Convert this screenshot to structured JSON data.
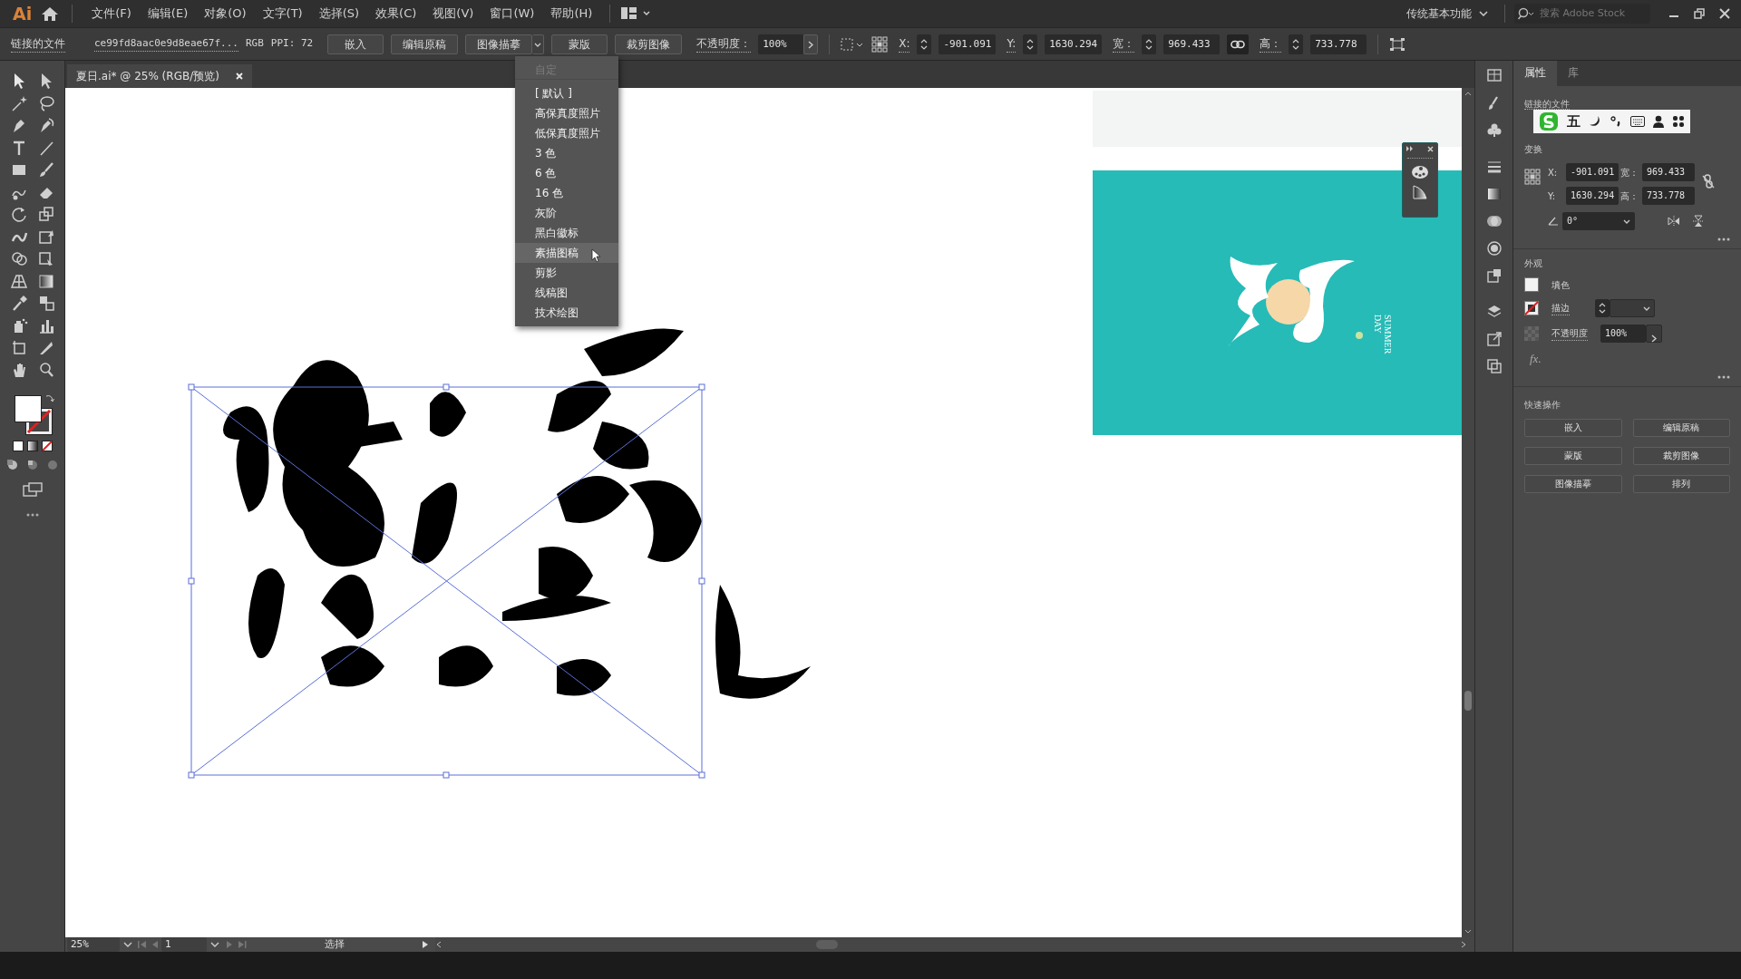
{
  "menubar": {
    "app_logo": "Ai",
    "menus": [
      "文件(F)",
      "编辑(E)",
      "对象(O)",
      "文字(T)",
      "选择(S)",
      "效果(C)",
      "视图(V)",
      "窗口(W)",
      "帮助(H)"
    ],
    "workspace": "传统基本功能",
    "search": {
      "placeholder": "搜索 Adobe Stock"
    }
  },
  "control_bar": {
    "label": "链接的文件",
    "filename": "ce99fd8aac0e9d8eae67f...",
    "color_mode": "RGB",
    "ppi": "PPI: 72",
    "buttons": [
      {
        "label": "嵌入",
        "kind": "plain"
      },
      {
        "label": "编辑原稿",
        "kind": "plain"
      },
      {
        "label": "图像描摹",
        "kind": "split"
      },
      {
        "label": "蒙版",
        "kind": "plain"
      },
      {
        "label": "裁剪图像",
        "kind": "plain"
      }
    ],
    "opacity_label": "不透明度：",
    "opacity": "100%",
    "fields": [
      {
        "label": "X:",
        "value": "-901.091"
      },
      {
        "label": "Y:",
        "value": "1630.294"
      },
      {
        "label": "宽：",
        "value": "969.433"
      },
      {
        "label": "高：",
        "value": "733.778"
      }
    ],
    "constrain_proportions": true
  },
  "document_tab": {
    "title": "夏日.ai* @ 25% (RGB/预览)"
  },
  "trace_menu": {
    "items": [
      {
        "label": "自定",
        "disabled": true,
        "highlighted": false
      },
      {
        "label": "[ 默认 ]",
        "disabled": false,
        "highlighted": false
      },
      {
        "label": "高保真度照片",
        "disabled": false,
        "highlighted": false
      },
      {
        "label": "低保真度照片",
        "disabled": false,
        "highlighted": false
      },
      {
        "label": "3 色",
        "disabled": false,
        "highlighted": false
      },
      {
        "label": "6 色",
        "disabled": false,
        "highlighted": false
      },
      {
        "label": "16 色",
        "disabled": false,
        "highlighted": false
      },
      {
        "label": "灰阶",
        "disabled": false,
        "highlighted": false
      },
      {
        "label": "黑白徽标",
        "disabled": false,
        "highlighted": false
      },
      {
        "label": "素描图稿",
        "disabled": false,
        "highlighted": true
      },
      {
        "label": "剪影",
        "disabled": false,
        "highlighted": false
      },
      {
        "label": "线稿图",
        "disabled": false,
        "highlighted": false
      },
      {
        "label": "技术绘图",
        "disabled": false,
        "highlighted": false
      }
    ]
  },
  "artboard": {
    "caption": [
      "SUMMER",
      "DAY"
    ]
  },
  "properties_panel": {
    "tabs": [
      {
        "label": "属性",
        "selected": true
      },
      {
        "label": "库",
        "selected": false
      }
    ],
    "linked_file_label": "链接的文件",
    "ime_bar": {
      "mode": "五"
    },
    "transform": {
      "title": "变换",
      "fields": [
        {
          "label": "X:",
          "value": "-901.091"
        },
        {
          "label": "宽：",
          "value": "969.433"
        },
        {
          "label": "Y:",
          "value": "1630.294"
        },
        {
          "label": "高：",
          "value": "733.778"
        }
      ],
      "angle": "0°"
    },
    "appearance": {
      "title": "外观",
      "fill_label": "填色",
      "stroke_label": "描边",
      "opacity_label": "不透明度",
      "opacity": "100%",
      "fx": "fx."
    },
    "quick_actions": {
      "title": "快速操作",
      "buttons": [
        "嵌入",
        "编辑原稿",
        "蒙版",
        "裁剪图像",
        "图像描摹",
        "排列"
      ]
    }
  },
  "status_bar": {
    "zoom": "25%",
    "page": "1",
    "tool": "选择"
  }
}
